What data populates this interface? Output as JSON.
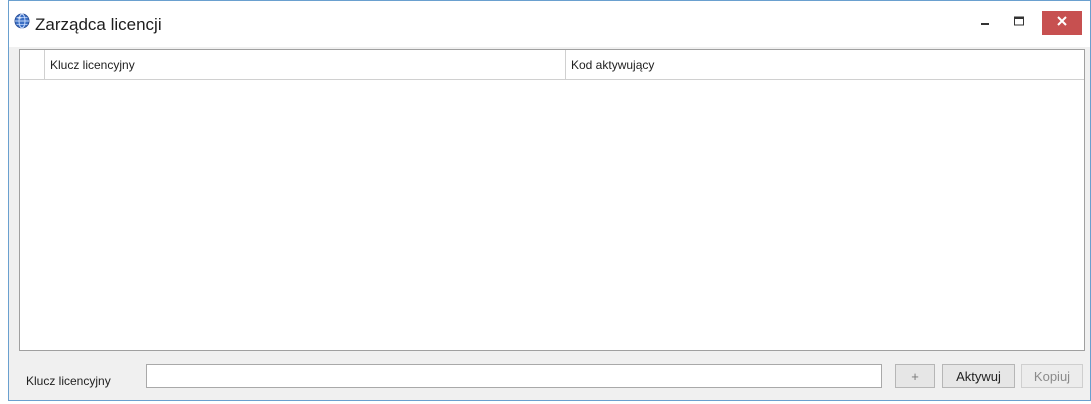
{
  "window": {
    "title": "Zarządca licencji",
    "close_color": "#c75050",
    "border_color": "#6aa0cf"
  },
  "icons": {
    "app": "globe-icon",
    "minimize": "minimize-icon",
    "maximize": "maximize-icon",
    "close": "close-icon"
  },
  "grid": {
    "columns": [
      "Klucz licencyjny",
      "Kod aktywujący"
    ],
    "rows": []
  },
  "form": {
    "key_label": "Klucz licencyjny",
    "key_value": "",
    "add_label": "+",
    "activate_label": "Aktywuj",
    "copy_label": "Kopiuj"
  }
}
